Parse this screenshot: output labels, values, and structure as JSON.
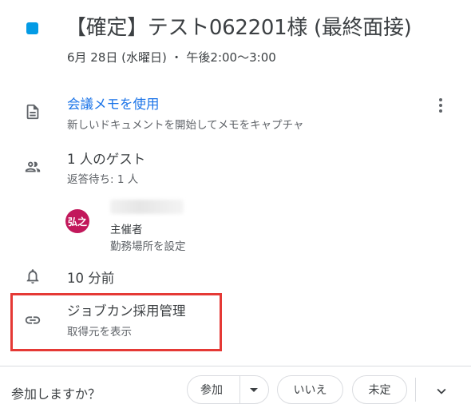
{
  "event": {
    "title": "【確定】テスト062201様 (最終面接)",
    "datetime": "6月 28日 (水曜日) ・ 午後2:00～3:00",
    "color": "#039be5"
  },
  "notes": {
    "link_label": "会議メモを使用",
    "description": "新しいドキュメントを開始してメモをキャプチャ"
  },
  "guests": {
    "count_label": "1 人のゲスト",
    "pending_label": "返答待ち: 1 人",
    "organizer": {
      "avatar_text": "弘之",
      "role_label": "主催者",
      "set_location_link": "勤務場所を設定"
    }
  },
  "reminder": {
    "label": "10 分前"
  },
  "attachment": {
    "title": "ジョブカン採用管理",
    "subtitle": "取得元を表示"
  },
  "rsvp": {
    "question": "参加しますか？",
    "yes_label": "参加",
    "no_label": "いいえ",
    "maybe_label": "未定"
  },
  "colors": {
    "accent": "#1a73e8",
    "highlight": "#e53935",
    "avatar_bg": "#c2185b"
  }
}
